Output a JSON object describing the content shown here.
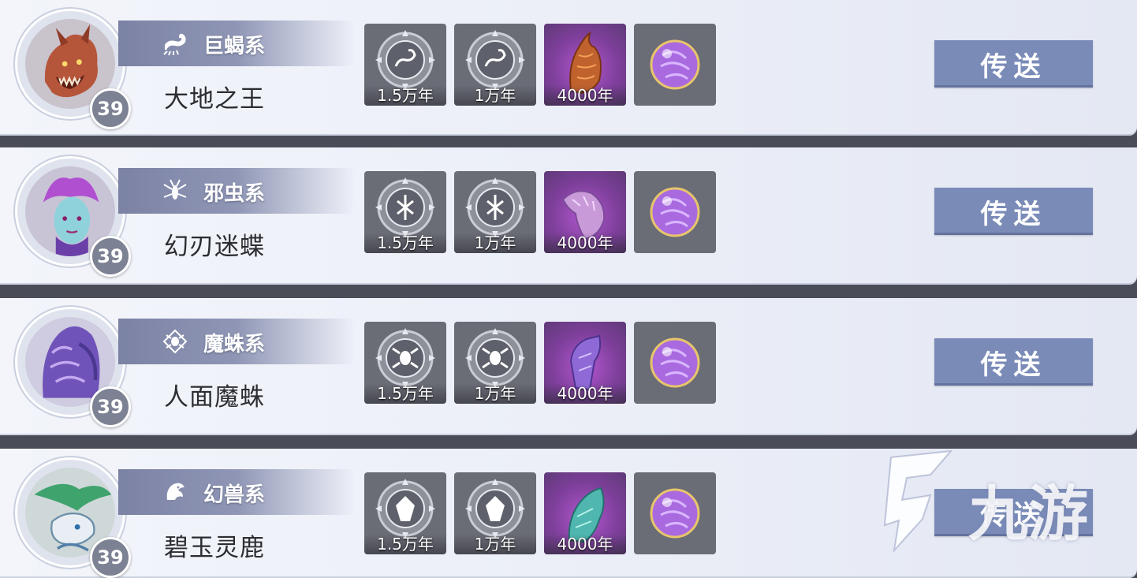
{
  "beasts": [
    {
      "series": "巨蝎系",
      "series_icon": "scorpion-icon",
      "name": "大地之王",
      "level": "39",
      "rewards": [
        "1.5万年",
        "1万年",
        "4000年",
        ""
      ],
      "button": "传送",
      "accent": "#a0522d"
    },
    {
      "series": "邪虫系",
      "series_icon": "insect-icon",
      "name": "幻刃迷蝶",
      "level": "39",
      "rewards": [
        "1.5万年",
        "1万年",
        "4000年",
        ""
      ],
      "button": "传送",
      "accent": "#8a3fb6"
    },
    {
      "series": "魔蛛系",
      "series_icon": "spider-icon",
      "name": "人面魔蛛",
      "level": "39",
      "rewards": [
        "1.5万年",
        "1万年",
        "4000年",
        ""
      ],
      "button": "传送",
      "accent": "#6a4fb0"
    },
    {
      "series": "幻兽系",
      "series_icon": "dragon-icon",
      "name": "碧玉灵鹿",
      "level": "39",
      "rewards": [
        "1.5万年",
        "1万年",
        "4000年",
        ""
      ],
      "button": "传送",
      "accent": "#3f9a6e"
    }
  ],
  "watermark": {
    "text": "九游"
  }
}
